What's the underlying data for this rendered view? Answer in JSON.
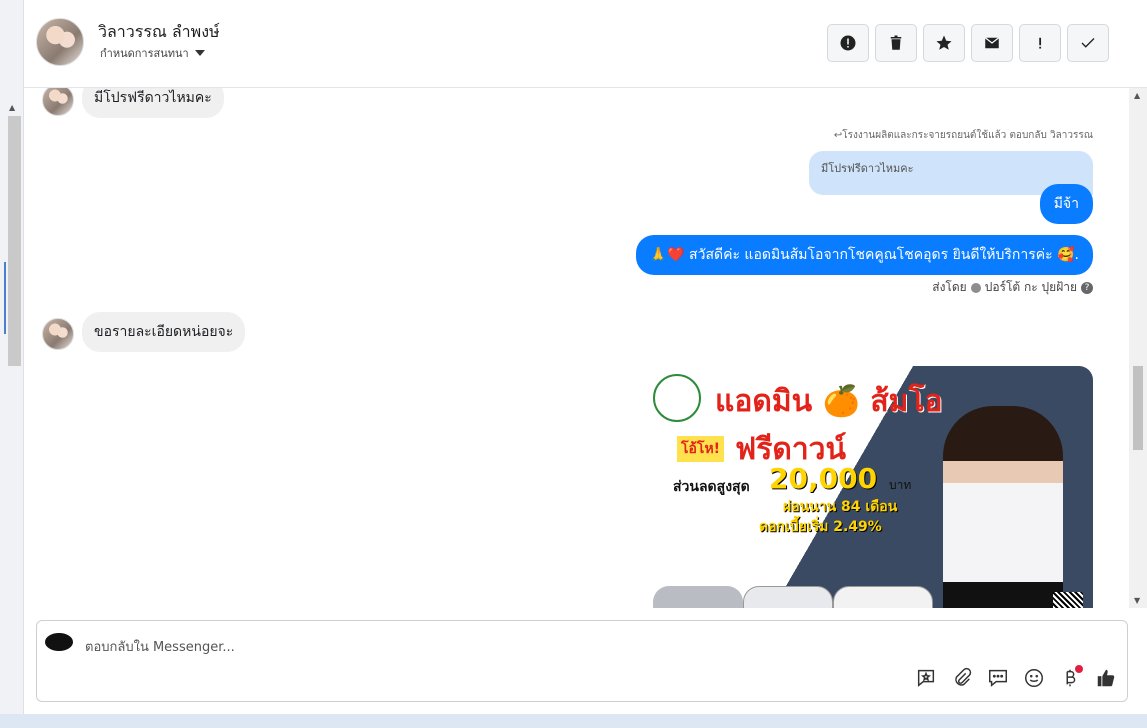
{
  "header": {
    "contact_name": "วิลาวรรณ ลำพงษ์",
    "assign_label": "กำหนดการสนทนา",
    "tools": [
      "report-icon",
      "trash-icon",
      "star-icon",
      "mail-icon",
      "exclamation-icon",
      "check-icon"
    ]
  },
  "messages": {
    "incoming_1": "มีโปรฟรีดาวไหมคะ",
    "reply_note": "↩โรงงานผลิตและกระจายรถยนต์ใช้แล้ว ตอบกลับ วิลาวรรณ",
    "quoted": "มีโปรฟรีดาวไหมคะ",
    "outgoing_1": "มีจ้า",
    "outgoing_2": "🙏❤️ สวัสดีค่ะ แอดมินส้มโอจากโชคคูณโชคอุดร ยินดีให้บริการค่ะ 🥰.",
    "sent_by_prefix": "ส่งโดย",
    "sent_by_name": "ปอร์โต้ กะ ปุยฝ้าย",
    "incoming_2": "ขอรายละเอียดหน่อยจะ"
  },
  "poster": {
    "brand": "แอดมิน 🍊 ส้มโอ",
    "ohi": "โอ้โห!",
    "free": "ฟรีดาวน์",
    "discount_label": "ส่วนลดสูงสุด",
    "discount_amount": "20,000",
    "baht": "บาท",
    "installment": "ผ่อนนาน 84 เดือน",
    "rate": "ดอกเบี้ยเริ่ม 2.49%"
  },
  "composer": {
    "placeholder": "ตอบกลับใน Messenger...",
    "icons": [
      "reply-icon",
      "attachment-icon",
      "saved-replies-icon",
      "emoji-icon",
      "baht-icon",
      "like-icon"
    ]
  },
  "colors": {
    "accent": "#0a7cff",
    "quoted_bg": "#cfe3fb",
    "incoming_bg": "#f0f0f0"
  }
}
